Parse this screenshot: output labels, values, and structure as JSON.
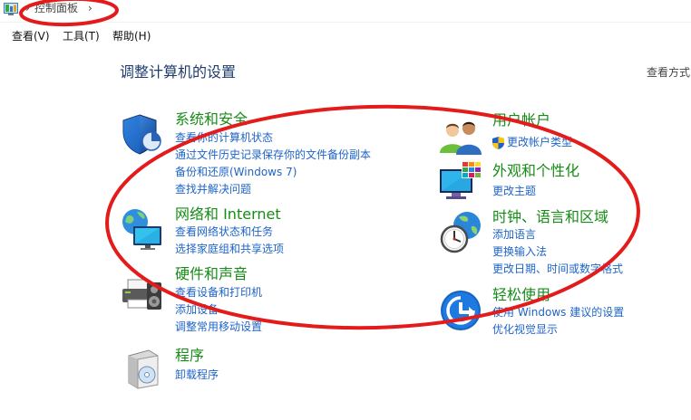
{
  "address_bar": {
    "icon": "control-panel-icon",
    "separator": "›",
    "location": "控制面板",
    "trailing_separator": "›"
  },
  "menu": {
    "items": [
      {
        "label": "查看(V)"
      },
      {
        "label": "工具(T)"
      },
      {
        "label": "帮助(H)"
      }
    ]
  },
  "main": {
    "heading": "调整计算机的设置",
    "view_by_label": "查看方式",
    "left_column": [
      {
        "icon": "security-shield-icon",
        "title": "系统和安全",
        "links": [
          "查看你的计算机状态",
          "通过文件历史记录保存你的文件备份副本",
          "备份和还原(Windows 7)",
          "查找并解决问题"
        ]
      },
      {
        "icon": "network-globe-icon",
        "title": "网络和 Internet",
        "links": [
          "查看网络状态和任务",
          "选择家庭组和共享选项"
        ]
      },
      {
        "icon": "printer-speaker-icon",
        "title": "硬件和声音",
        "links": [
          "查看设备和打印机",
          "添加设备",
          "调整常用移动设置"
        ]
      },
      {
        "icon": "programs-box-icon",
        "title": "程序",
        "links": [
          "卸载程序"
        ]
      }
    ],
    "right_column": [
      {
        "icon": "users-icon",
        "title": "用户帐户",
        "link_icon": "uac-shield-icon",
        "links": [
          "更改帐户类型"
        ]
      },
      {
        "icon": "appearance-monitor-icon",
        "title": "外观和个性化",
        "links": [
          "更改主题"
        ]
      },
      {
        "icon": "clock-globe-icon",
        "title": "时钟、语言和区域",
        "links": [
          "添加语言",
          "更换输入法",
          "更改日期、时间或数字格式"
        ]
      },
      {
        "icon": "ease-of-access-icon",
        "title": "轻松使用",
        "links": [
          "使用 Windows 建议的设置",
          "优化视觉显示"
        ]
      }
    ]
  },
  "colors": {
    "background": "#ffffff",
    "heading": "#1f3c6e",
    "category_title": "#168c16",
    "link": "#1e64c8",
    "annotation": "#e31b1b"
  }
}
